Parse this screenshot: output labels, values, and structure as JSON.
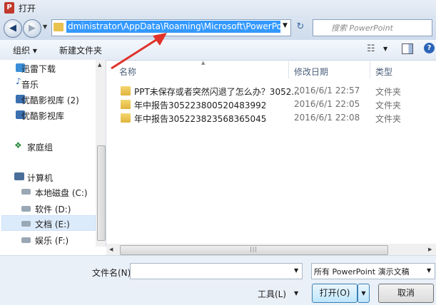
{
  "window": {
    "title": "打开"
  },
  "nav": {
    "address": "dministrator\\AppData\\Roaming\\Microsoft\\PowerPoint",
    "search_placeholder": "搜索 PowerPoint"
  },
  "toolbar": {
    "organize": "组织 ▾",
    "new_folder": "新建文件夹"
  },
  "sidebar": {
    "items": [
      {
        "label": "迅雷下载",
        "icon": "download-folder-icon"
      },
      {
        "label": "音乐",
        "icon": "music-icon"
      },
      {
        "label": "优酷影视库 (2)",
        "icon": "video-library-icon"
      },
      {
        "label": "优酷影视库",
        "icon": "video-library-icon"
      },
      {
        "label": "家庭组",
        "icon": "homegroup-icon"
      },
      {
        "label": "计算机",
        "icon": "computer-icon"
      },
      {
        "label": "本地磁盘 (C:)",
        "icon": "drive-icon"
      },
      {
        "label": "软件 (D:)",
        "icon": "drive-icon"
      },
      {
        "label": "文档 (E:)",
        "icon": "drive-icon"
      },
      {
        "label": "娱乐 (F:)",
        "icon": "drive-icon"
      }
    ]
  },
  "list": {
    "columns": {
      "name": "名称",
      "date": "修改日期",
      "type": "类型"
    },
    "rows": [
      {
        "name": "PPT未保存或者突然闪退了怎么办？3052...",
        "date": "2016/6/1 22:57",
        "type": "文件夹"
      },
      {
        "name": "年中报告305223800520483992",
        "date": "2016/6/1 22:05",
        "type": "文件夹"
      },
      {
        "name": "年中报告305223823568365045",
        "date": "2016/6/1 22:08",
        "type": "文件夹"
      }
    ]
  },
  "footer": {
    "filename_label": "文件名(N):",
    "filename_value": "",
    "filetype": "所有 PowerPoint 演示文稿",
    "tools": "工具(L)",
    "open": "打开(O)",
    "cancel": "取消"
  },
  "colors": {
    "address_highlight": "#3399ff",
    "annotation_arrow": "#e0322a",
    "folder": "#e8c14f"
  }
}
